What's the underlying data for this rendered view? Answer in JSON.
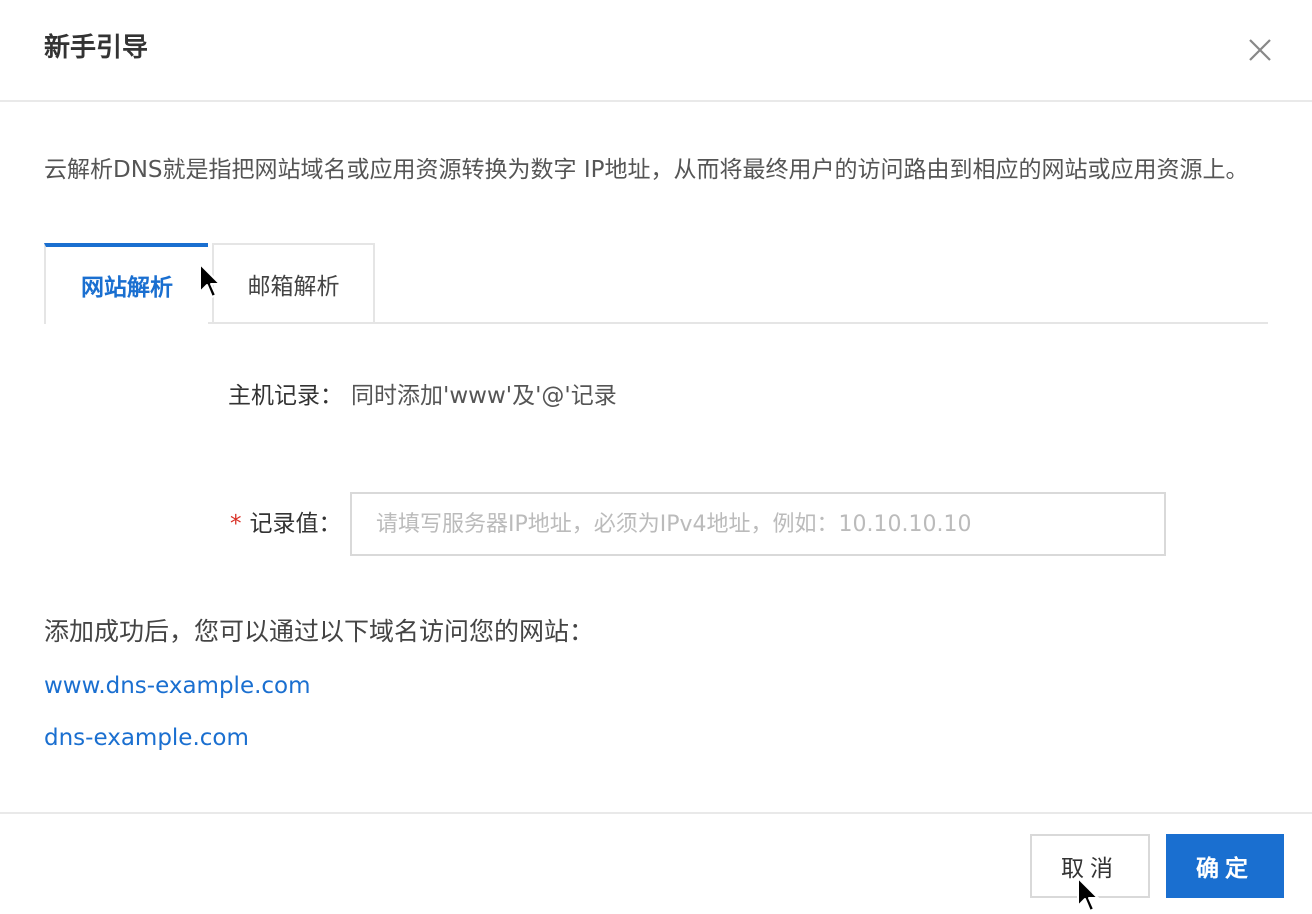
{
  "dialog": {
    "title": "新手引导",
    "close_icon": "close-icon"
  },
  "intro": {
    "text": "云解析DNS就是指把网站域名或应用资源转换为数字 IP地址，从而将最终用户的访问路由到相应的网站或应用资源上。"
  },
  "tabs": [
    {
      "label": "网站解析",
      "active": true
    },
    {
      "label": "邮箱解析",
      "active": false
    }
  ],
  "form": {
    "host_label": "主机记录：",
    "host_value": "同时添加'www'及'@'记录",
    "record_required_mark": "*",
    "record_label": "记录值：",
    "record_value": "",
    "record_placeholder": "请填写服务器IP地址，必须为IPv4地址，例如：10.10.10.10"
  },
  "result": {
    "success_text": "添加成功后，您可以通过以下域名访问您的网站：",
    "domains": [
      "www.dns-example.com",
      "dns-example.com"
    ]
  },
  "footer": {
    "cancel_label": "取消",
    "confirm_label": "确定"
  },
  "colors": {
    "accent": "#1a6fd0",
    "required": "#d93026",
    "border": "#d9d9d9"
  }
}
